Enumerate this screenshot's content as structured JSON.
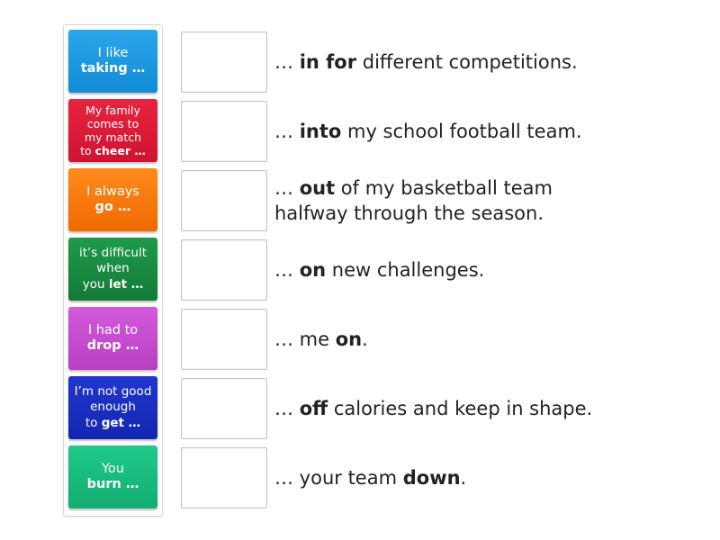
{
  "activity": {
    "type": "match-up",
    "tiles": [
      {
        "lines": [
          {
            "text": "I like",
            "bold": ""
          },
          {
            "text": "",
            "bold": "taking …"
          }
        ],
        "color": "#2aa6ea",
        "color_dark": "#148bd6"
      },
      {
        "lines": [
          {
            "text": "My family",
            "bold": ""
          },
          {
            "text": "comes to",
            "bold": ""
          },
          {
            "text": "my match",
            "bold": ""
          },
          {
            "text": "to ",
            "bold": "cheer …"
          }
        ],
        "color": "#e8243f",
        "color_dark": "#cf1331"
      },
      {
        "lines": [
          {
            "text": "I always",
            "bold": ""
          },
          {
            "text": "",
            "bold": "go …"
          }
        ],
        "color": "#ff8a1c",
        "color_dark": "#f06a00"
      },
      {
        "lines": [
          {
            "text": "it’s difficult",
            "bold": ""
          },
          {
            "text": "when",
            "bold": ""
          },
          {
            "text": "you ",
            "bold": "let …"
          }
        ],
        "color": "#1e9a4a",
        "color_dark": "#137a37"
      },
      {
        "lines": [
          {
            "text": "I had to",
            "bold": ""
          },
          {
            "text": "",
            "bold": "drop …"
          }
        ],
        "color": "#d45adc",
        "color_dark": "#b73fc2"
      },
      {
        "lines": [
          {
            "text": "I’m not good",
            "bold": ""
          },
          {
            "text": "enough",
            "bold": ""
          },
          {
            "text": "to ",
            "bold": "get …"
          }
        ],
        "color": "#2037cf",
        "color_dark": "#1326b0"
      },
      {
        "lines": [
          {
            "text": "You",
            "bold": ""
          },
          {
            "text": "",
            "bold": "burn …"
          }
        ],
        "color": "#20c98a",
        "color_dark": "#13ad72"
      }
    ],
    "sentences": [
      {
        "parts": [
          {
            "text": "… ",
            "bold": false
          },
          {
            "text": "in for",
            "bold": true
          },
          {
            "text": " different competitions.",
            "bold": false
          }
        ]
      },
      {
        "parts": [
          {
            "text": "… ",
            "bold": false
          },
          {
            "text": "into",
            "bold": true
          },
          {
            "text": " my school football team.",
            "bold": false
          }
        ]
      },
      {
        "parts": [
          {
            "text": "… ",
            "bold": false
          },
          {
            "text": "out",
            "bold": true
          },
          {
            "text": " of my basketball team halfway through the season.",
            "bold": false
          }
        ]
      },
      {
        "parts": [
          {
            "text": "… ",
            "bold": false
          },
          {
            "text": "on",
            "bold": true
          },
          {
            "text": " new challenges.",
            "bold": false
          }
        ]
      },
      {
        "parts": [
          {
            "text": "… me ",
            "bold": false
          },
          {
            "text": "on",
            "bold": true
          },
          {
            "text": ".",
            "bold": false
          }
        ]
      },
      {
        "parts": [
          {
            "text": "… ",
            "bold": false
          },
          {
            "text": "off",
            "bold": true
          },
          {
            "text": " calories and keep in shape.",
            "bold": false
          }
        ]
      },
      {
        "parts": [
          {
            "text": "… your team ",
            "bold": false
          },
          {
            "text": "down",
            "bold": true
          },
          {
            "text": ".",
            "bold": false
          }
        ]
      }
    ]
  }
}
